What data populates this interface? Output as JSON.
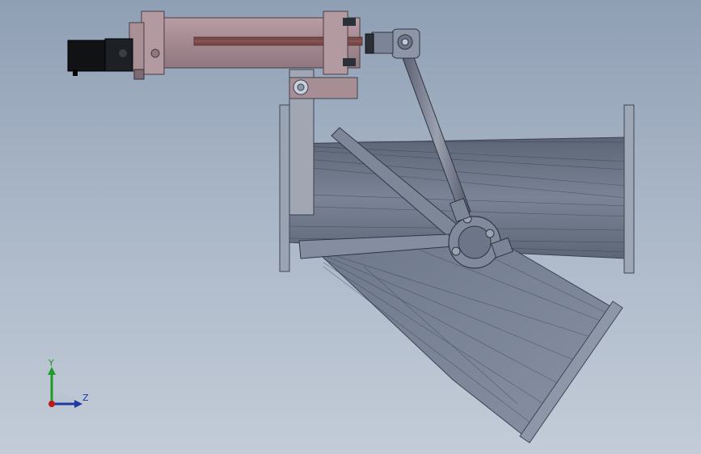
{
  "viewport": {
    "background_top": "#8f9fb4",
    "background_bottom": "#c3ccd8"
  },
  "model": {
    "parts": [
      "electric-actuator-motor",
      "pneumatic-cylinder",
      "mounting-bracket",
      "linkage-rod",
      "y-pipe-body",
      "diverter-flap",
      "pipe-flanges"
    ]
  },
  "triad": {
    "y_label": "Y",
    "z_label": "Z",
    "y_color": "#1f9a2a",
    "z_color": "#1e3aa0",
    "x_color": "#c01818"
  }
}
